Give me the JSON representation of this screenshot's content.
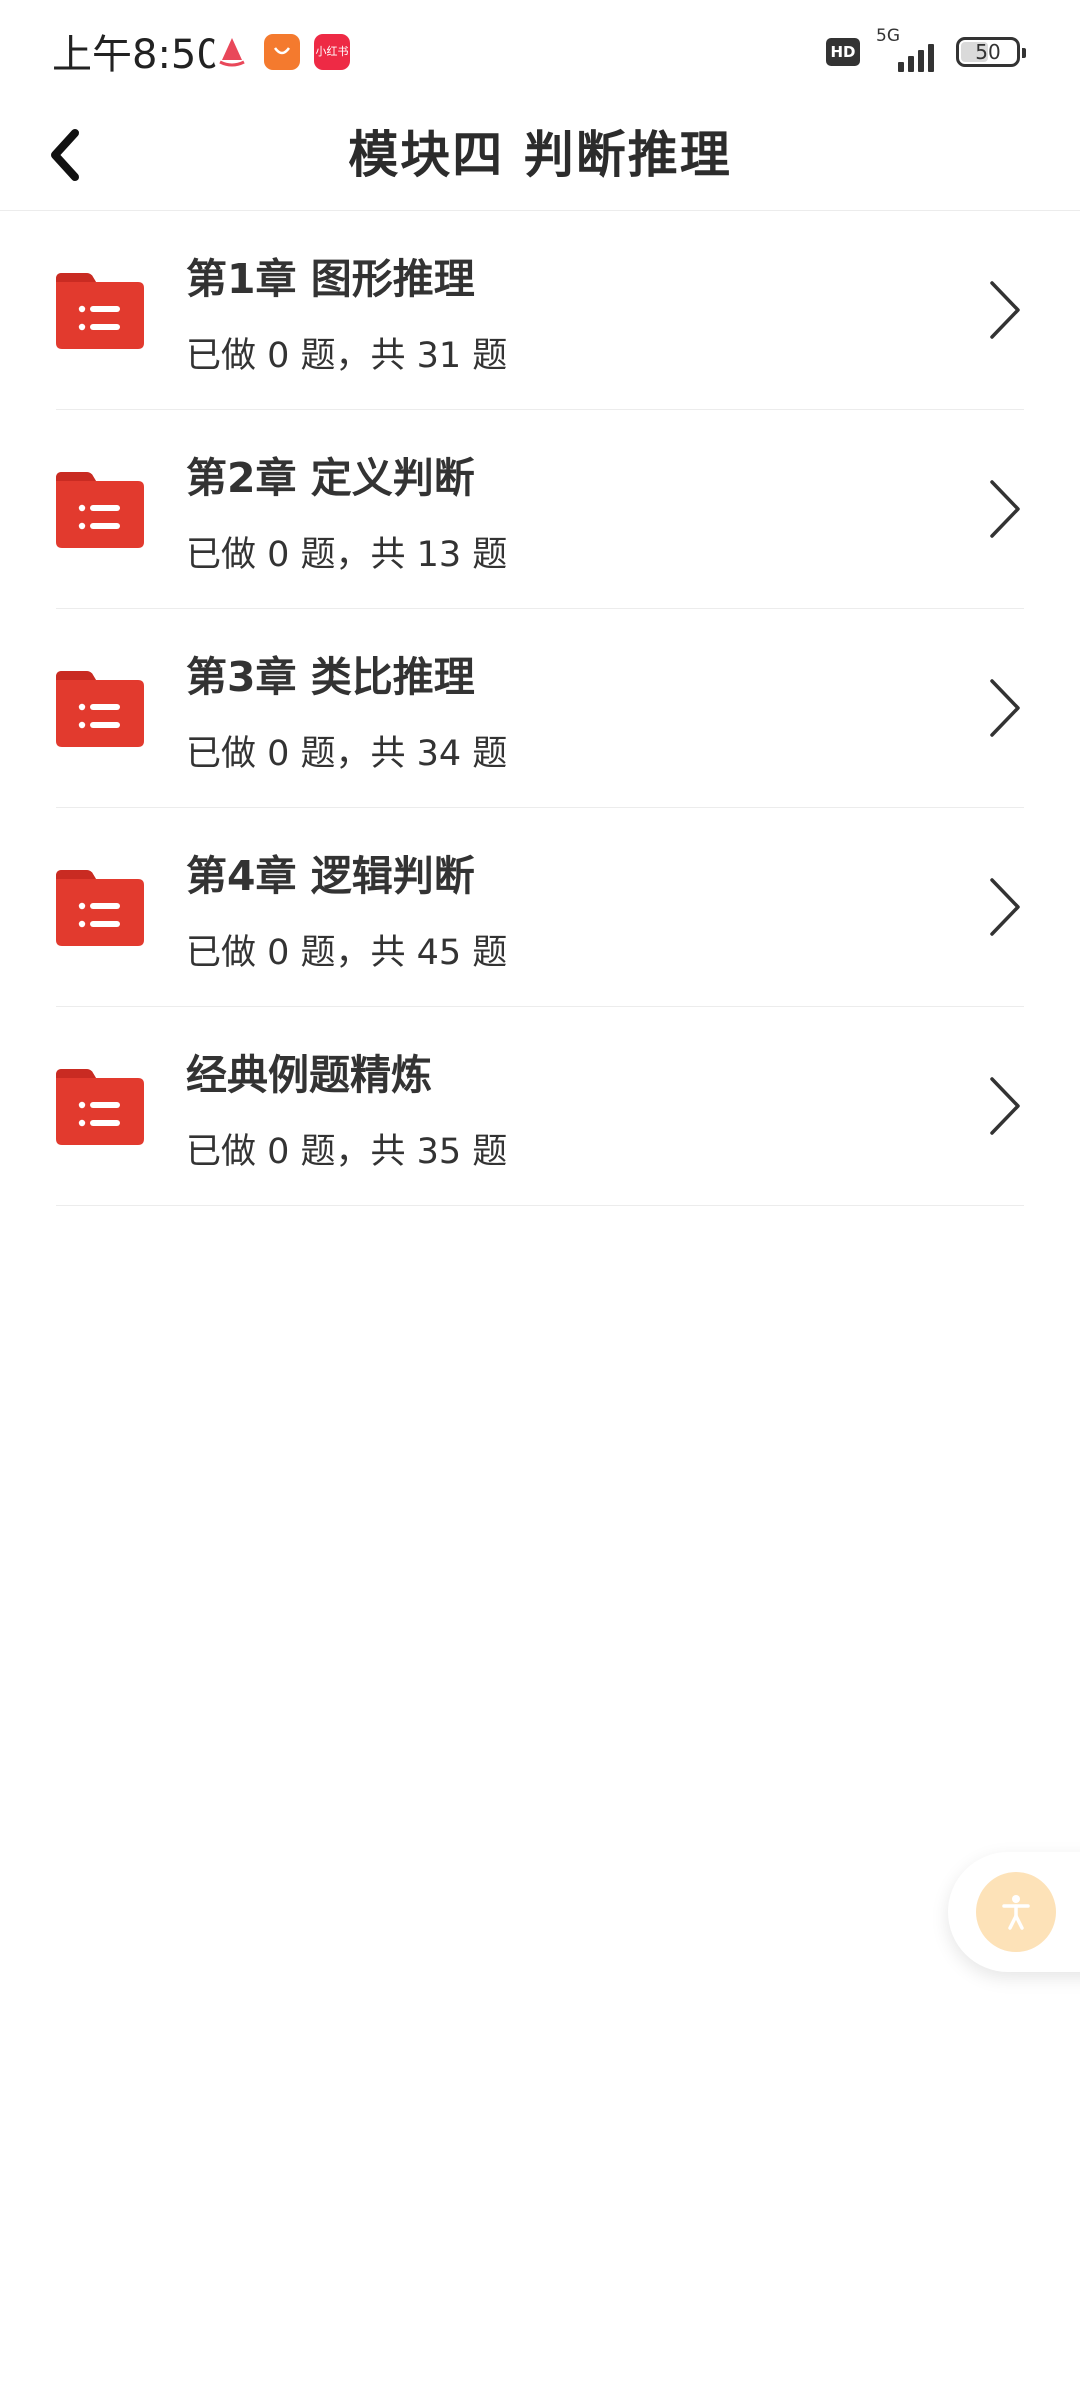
{
  "status_bar": {
    "time": "上午8:50",
    "app_icons": [
      {
        "name": "sailboat-app-icon",
        "color": "#e9485a",
        "label": ""
      },
      {
        "name": "shopping-app-icon",
        "color": "#f47a2e",
        "label": ""
      },
      {
        "name": "xiaohongshu-app-icon",
        "color": "#ee2a45",
        "label": "小红书"
      }
    ],
    "hd_label": "HD",
    "network_label": "5G",
    "battery_level": "50",
    "battery_fraction": 0.5
  },
  "header": {
    "title": "模块四 判断推理",
    "back_icon": "chevron-left-icon"
  },
  "chapters": [
    {
      "title": "第1章 图形推理",
      "progress": "已做 0 题，共 31 题"
    },
    {
      "title": "第2章 定义判断",
      "progress": "已做 0 题，共 13 题"
    },
    {
      "title": "第3章 类比推理",
      "progress": "已做 0 题，共 34 题"
    },
    {
      "title": "第4章 逻辑判断",
      "progress": "已做 0 题，共 45 题"
    },
    {
      "title": "经典例题精炼",
      "progress": "已做 0 题，共 35 题"
    }
  ],
  "colors": {
    "folder_red": "#e23a2e",
    "folder_tab": "#c92b22",
    "accent_orange_soft": "#fde2b8"
  },
  "floating": {
    "icon": "accessibility-icon"
  }
}
